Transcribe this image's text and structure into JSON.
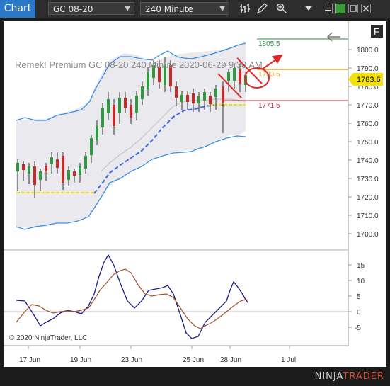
{
  "toolbar": {
    "app_label": "Chart",
    "instrument": "GC 08-20",
    "interval": "240 Minute"
  },
  "chart": {
    "info_text": "Remek!  Premium  GC 08-20  240 Minute  2020-06-29 9:30 AM",
    "copyright": "© 2020 NinjaTrader, LLC",
    "f_button": "F",
    "price_axis": [
      "1800.0",
      "1790.0",
      "1780.0",
      "1770.0",
      "1760.0",
      "1750.0",
      "1740.0",
      "1730.0",
      "1720.0",
      "1710.0",
      "1700.0"
    ],
    "osc_axis": [
      "15",
      "10",
      "5",
      "0",
      "-5"
    ],
    "date_axis": [
      "17 Jun",
      "19 Jun",
      "23 Jun",
      "25 Jun",
      "28 Jun",
      "1 Jul"
    ],
    "levels": {
      "upper": "1805.5",
      "mid": "1783.5",
      "lower": "1771.5"
    },
    "current_price": "1783.6"
  },
  "logo": {
    "part1": "NINJA",
    "part2": "TRADER"
  }
}
